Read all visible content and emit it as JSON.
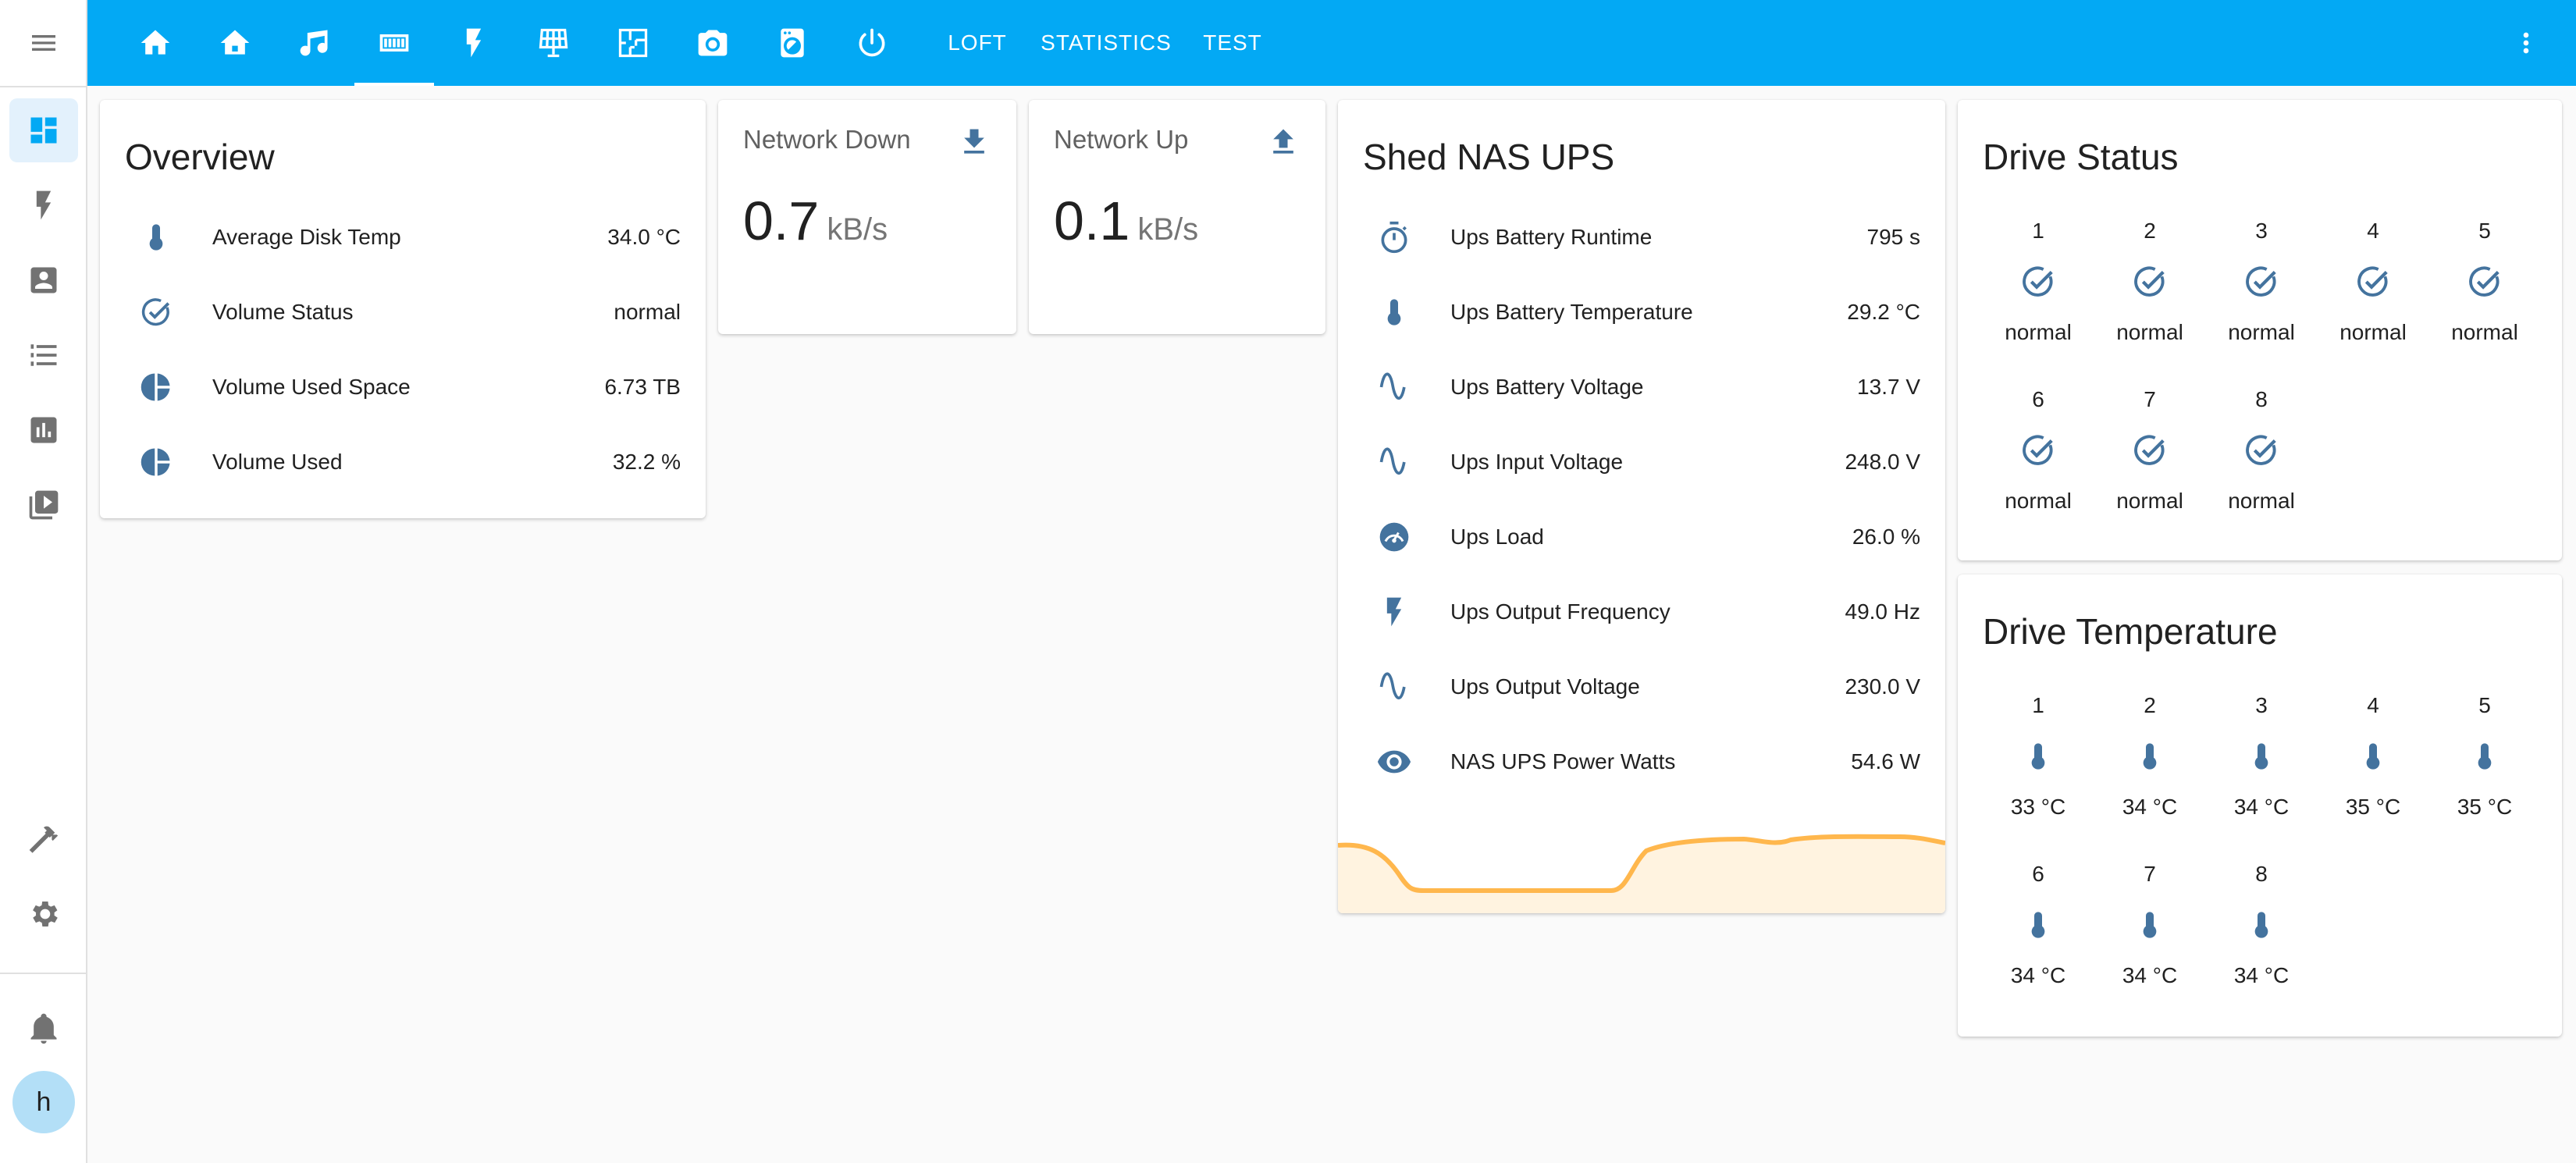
{
  "header": {
    "tabs": [
      {
        "icon": "home-icon"
      },
      {
        "icon": "home-roof-icon"
      },
      {
        "icon": "music-icon"
      },
      {
        "icon": "nas-drives-icon",
        "active": true
      },
      {
        "icon": "lightning-icon"
      },
      {
        "icon": "solar-panel-icon"
      },
      {
        "icon": "floor-plan-icon"
      },
      {
        "icon": "camera-icon"
      },
      {
        "icon": "washing-machine-icon"
      },
      {
        "icon": "power-icon"
      },
      {
        "label": "LOFT"
      },
      {
        "label": "STATISTICS"
      },
      {
        "label": "TEST"
      }
    ],
    "accent_color": "#03a9f4"
  },
  "sidebar": {
    "items": [
      {
        "icon": "dashboard-icon",
        "active": true
      },
      {
        "icon": "lightning-icon"
      },
      {
        "icon": "account-box-icon"
      },
      {
        "icon": "list-icon"
      },
      {
        "icon": "chart-icon"
      },
      {
        "icon": "media-icon"
      }
    ],
    "bottom": [
      {
        "icon": "hammer-icon"
      },
      {
        "icon": "gear-icon"
      },
      {
        "icon": "bell-icon"
      }
    ],
    "avatar_letter": "h"
  },
  "overview": {
    "title": "Overview",
    "rows": [
      {
        "icon": "thermometer-icon",
        "name": "Average Disk Temp",
        "value": "34.0 °C"
      },
      {
        "icon": "check-circle-icon",
        "name": "Volume Status",
        "value": "normal"
      },
      {
        "icon": "pie-icon",
        "name": "Volume Used Space",
        "value": "6.73 TB"
      },
      {
        "icon": "pie-icon",
        "name": "Volume Used",
        "value": "32.2 %"
      }
    ]
  },
  "network_down": {
    "title": "Network Down",
    "value": "0.7",
    "unit": "kB/s",
    "icon": "download-icon"
  },
  "network_up": {
    "title": "Network Up",
    "value": "0.1",
    "unit": "kB/s",
    "icon": "upload-icon"
  },
  "ups": {
    "title": "Shed NAS UPS",
    "rows": [
      {
        "icon": "timer-icon",
        "name": "Ups Battery Runtime",
        "value": "795 s"
      },
      {
        "icon": "thermometer-icon",
        "name": "Ups Battery Temperature",
        "value": "29.2 °C"
      },
      {
        "icon": "sine-wave-icon",
        "name": "Ups Battery Voltage",
        "value": "13.7 V"
      },
      {
        "icon": "sine-wave-icon",
        "name": "Ups Input Voltage",
        "value": "248.0 V"
      },
      {
        "icon": "gauge-icon",
        "name": "Ups Load",
        "value": "26.0 %"
      },
      {
        "icon": "lightning-icon",
        "name": "Ups Output Frequency",
        "value": "49.0 Hz"
      },
      {
        "icon": "sine-wave-icon",
        "name": "Ups Output Voltage",
        "value": "230.0 V"
      },
      {
        "icon": "eye-icon",
        "name": "NAS UPS Power Watts",
        "value": "54.6 W"
      }
    ],
    "graph_color": "#ffb74d"
  },
  "drive_status": {
    "title": "Drive Status",
    "items": [
      {
        "num": "1",
        "value": "normal"
      },
      {
        "num": "2",
        "value": "normal"
      },
      {
        "num": "3",
        "value": "normal"
      },
      {
        "num": "4",
        "value": "normal"
      },
      {
        "num": "5",
        "value": "normal"
      },
      {
        "num": "6",
        "value": "normal"
      },
      {
        "num": "7",
        "value": "normal"
      },
      {
        "num": "8",
        "value": "normal"
      }
    ]
  },
  "drive_temp": {
    "title": "Drive Temperature",
    "items": [
      {
        "num": "1",
        "value": "33 °C"
      },
      {
        "num": "2",
        "value": "34 °C"
      },
      {
        "num": "3",
        "value": "34 °C"
      },
      {
        "num": "4",
        "value": "35 °C"
      },
      {
        "num": "5",
        "value": "35 °C"
      },
      {
        "num": "6",
        "value": "34 °C"
      },
      {
        "num": "7",
        "value": "34 °C"
      },
      {
        "num": "8",
        "value": "34 °C"
      }
    ]
  },
  "colors": {
    "icon": "#44739e",
    "sidebar_icon": "#727272"
  }
}
